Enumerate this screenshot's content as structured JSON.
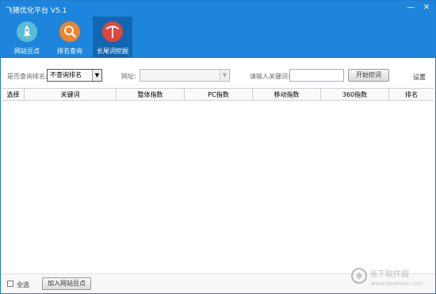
{
  "window": {
    "title": "飞猪优化平台 V5.1",
    "minimize_glyph": "—",
    "close_glyph": "✕"
  },
  "nav": {
    "items": [
      {
        "label": "网站豆点",
        "icon": "rocket-icon",
        "color": "#5bbcd3"
      },
      {
        "label": "排名查询",
        "icon": "magnifier-icon",
        "color": "#f0832b"
      },
      {
        "label": "长尾词挖掘",
        "icon": "pickaxe-icon",
        "color": "#e0463b"
      }
    ],
    "active_index": 2
  },
  "toolbar": {
    "query_rank_label": "是否查询排名:",
    "query_rank_value": "不查询排名",
    "url_label": "网址:",
    "url_value": "",
    "keyword_label": "请输入关键词:",
    "keyword_value": "",
    "start_button": "开始挖词",
    "settings_link": "设置"
  },
  "table": {
    "columns": [
      "选择",
      "关键词",
      "整体指数",
      "PC指数",
      "移动指数",
      "360指数",
      "排名"
    ],
    "rows": []
  },
  "footer": {
    "select_all_label": "全选",
    "select_all_checked": false,
    "add_button": "加入网站豆点"
  },
  "watermark": {
    "main": "当下软件园",
    "sub": "www.downxia.com"
  },
  "colors": {
    "brand_blue": "#1d86dc",
    "active_tab": "#1267b3"
  }
}
